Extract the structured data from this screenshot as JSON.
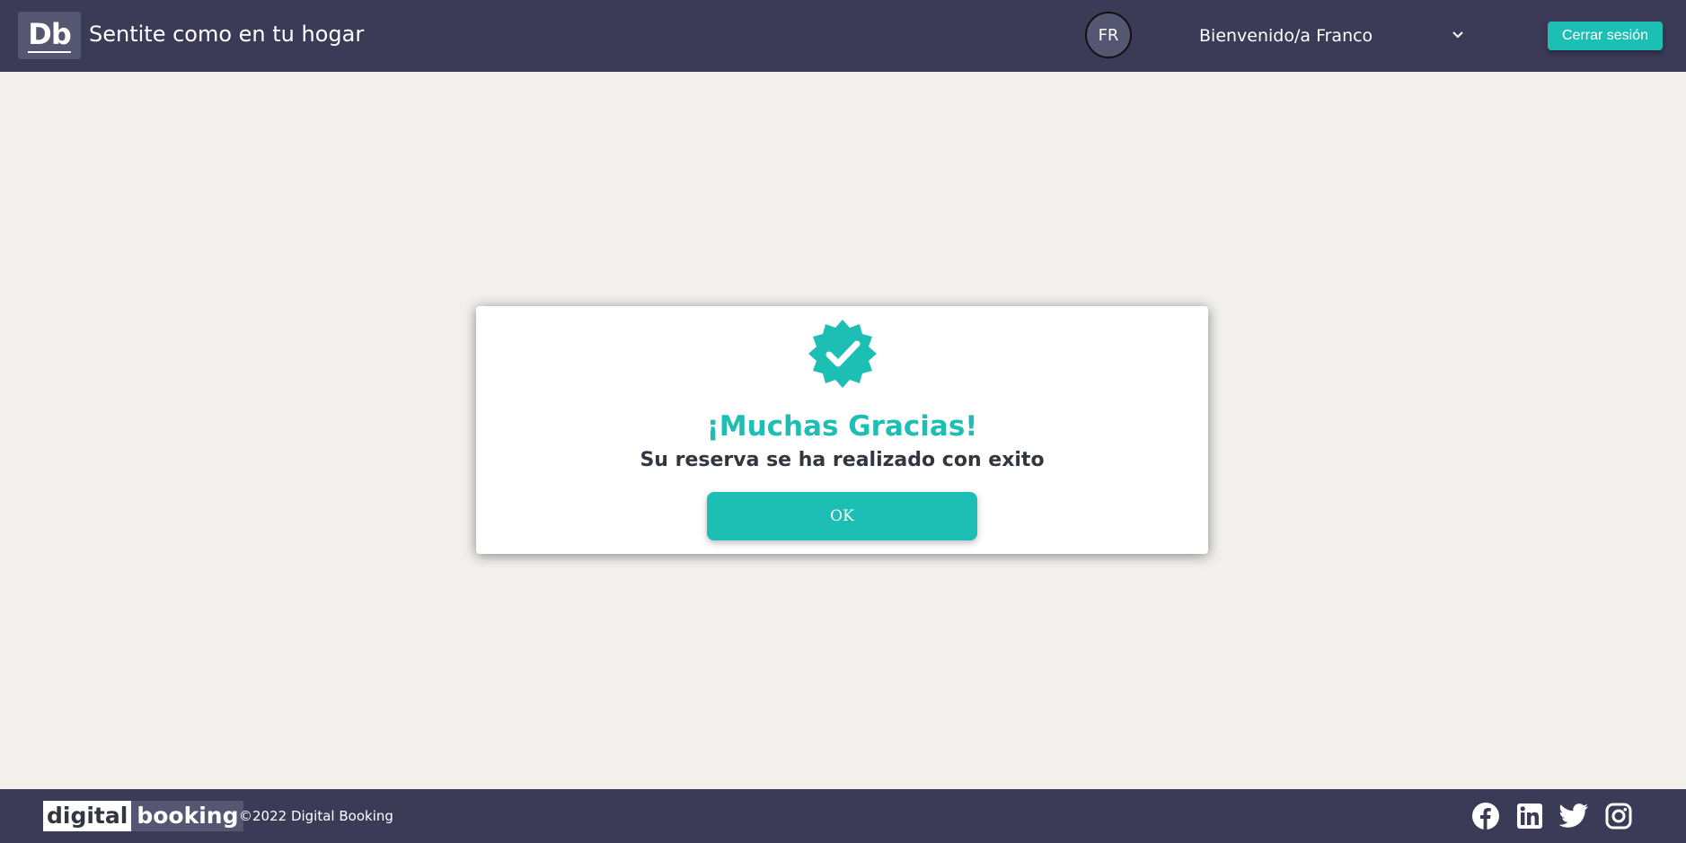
{
  "header": {
    "logo_text": "Db",
    "slogan": "Sentite como en tu hogar",
    "avatar_initials": "FR",
    "welcome_text": "Bienvenido/a Franco",
    "logout_label": "Cerrar sesión"
  },
  "modal": {
    "title": "¡Muchas Gracias!",
    "subtitle": "Su reserva se ha realizado con exito",
    "ok_label": "OK",
    "icon": "verified-badge-icon"
  },
  "footer": {
    "brand_part1": "digital",
    "brand_part2": "booking",
    "copyright": "©2022 Digital Booking",
    "social_icons": [
      "facebook-icon",
      "linkedin-icon",
      "twitter-icon",
      "instagram-icon"
    ]
  },
  "colors": {
    "header_bg": "#3b3b58",
    "accent": "#1dbeb4",
    "page_bg": "#f1f0ed",
    "dark_text": "#31363f"
  }
}
